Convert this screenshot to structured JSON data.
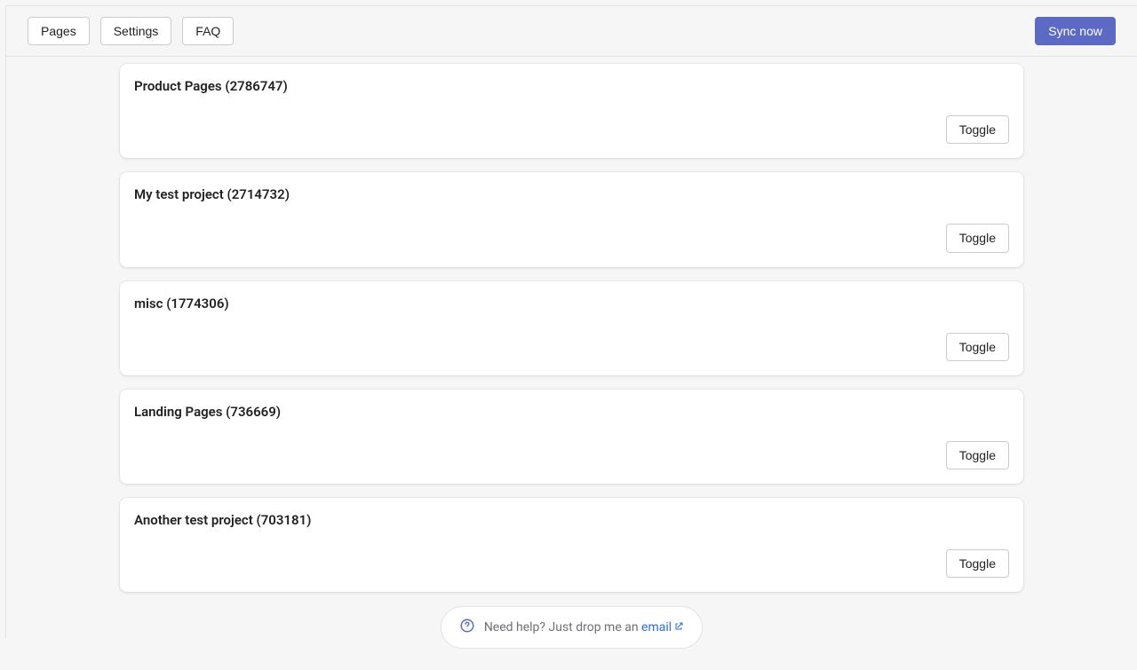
{
  "nav": {
    "pages": "Pages",
    "settings": "Settings",
    "faq": "FAQ",
    "sync": "Sync now"
  },
  "projects": [
    {
      "title": "Product Pages (2786747)",
      "toggle": "Toggle"
    },
    {
      "title": "My test project (2714732)",
      "toggle": "Toggle"
    },
    {
      "title": "misc (1774306)",
      "toggle": "Toggle"
    },
    {
      "title": "Landing Pages (736669)",
      "toggle": "Toggle"
    },
    {
      "title": "Another test project (703181)",
      "toggle": "Toggle"
    }
  ],
  "help": {
    "text": "Need help? Just drop me an ",
    "link": "email"
  }
}
